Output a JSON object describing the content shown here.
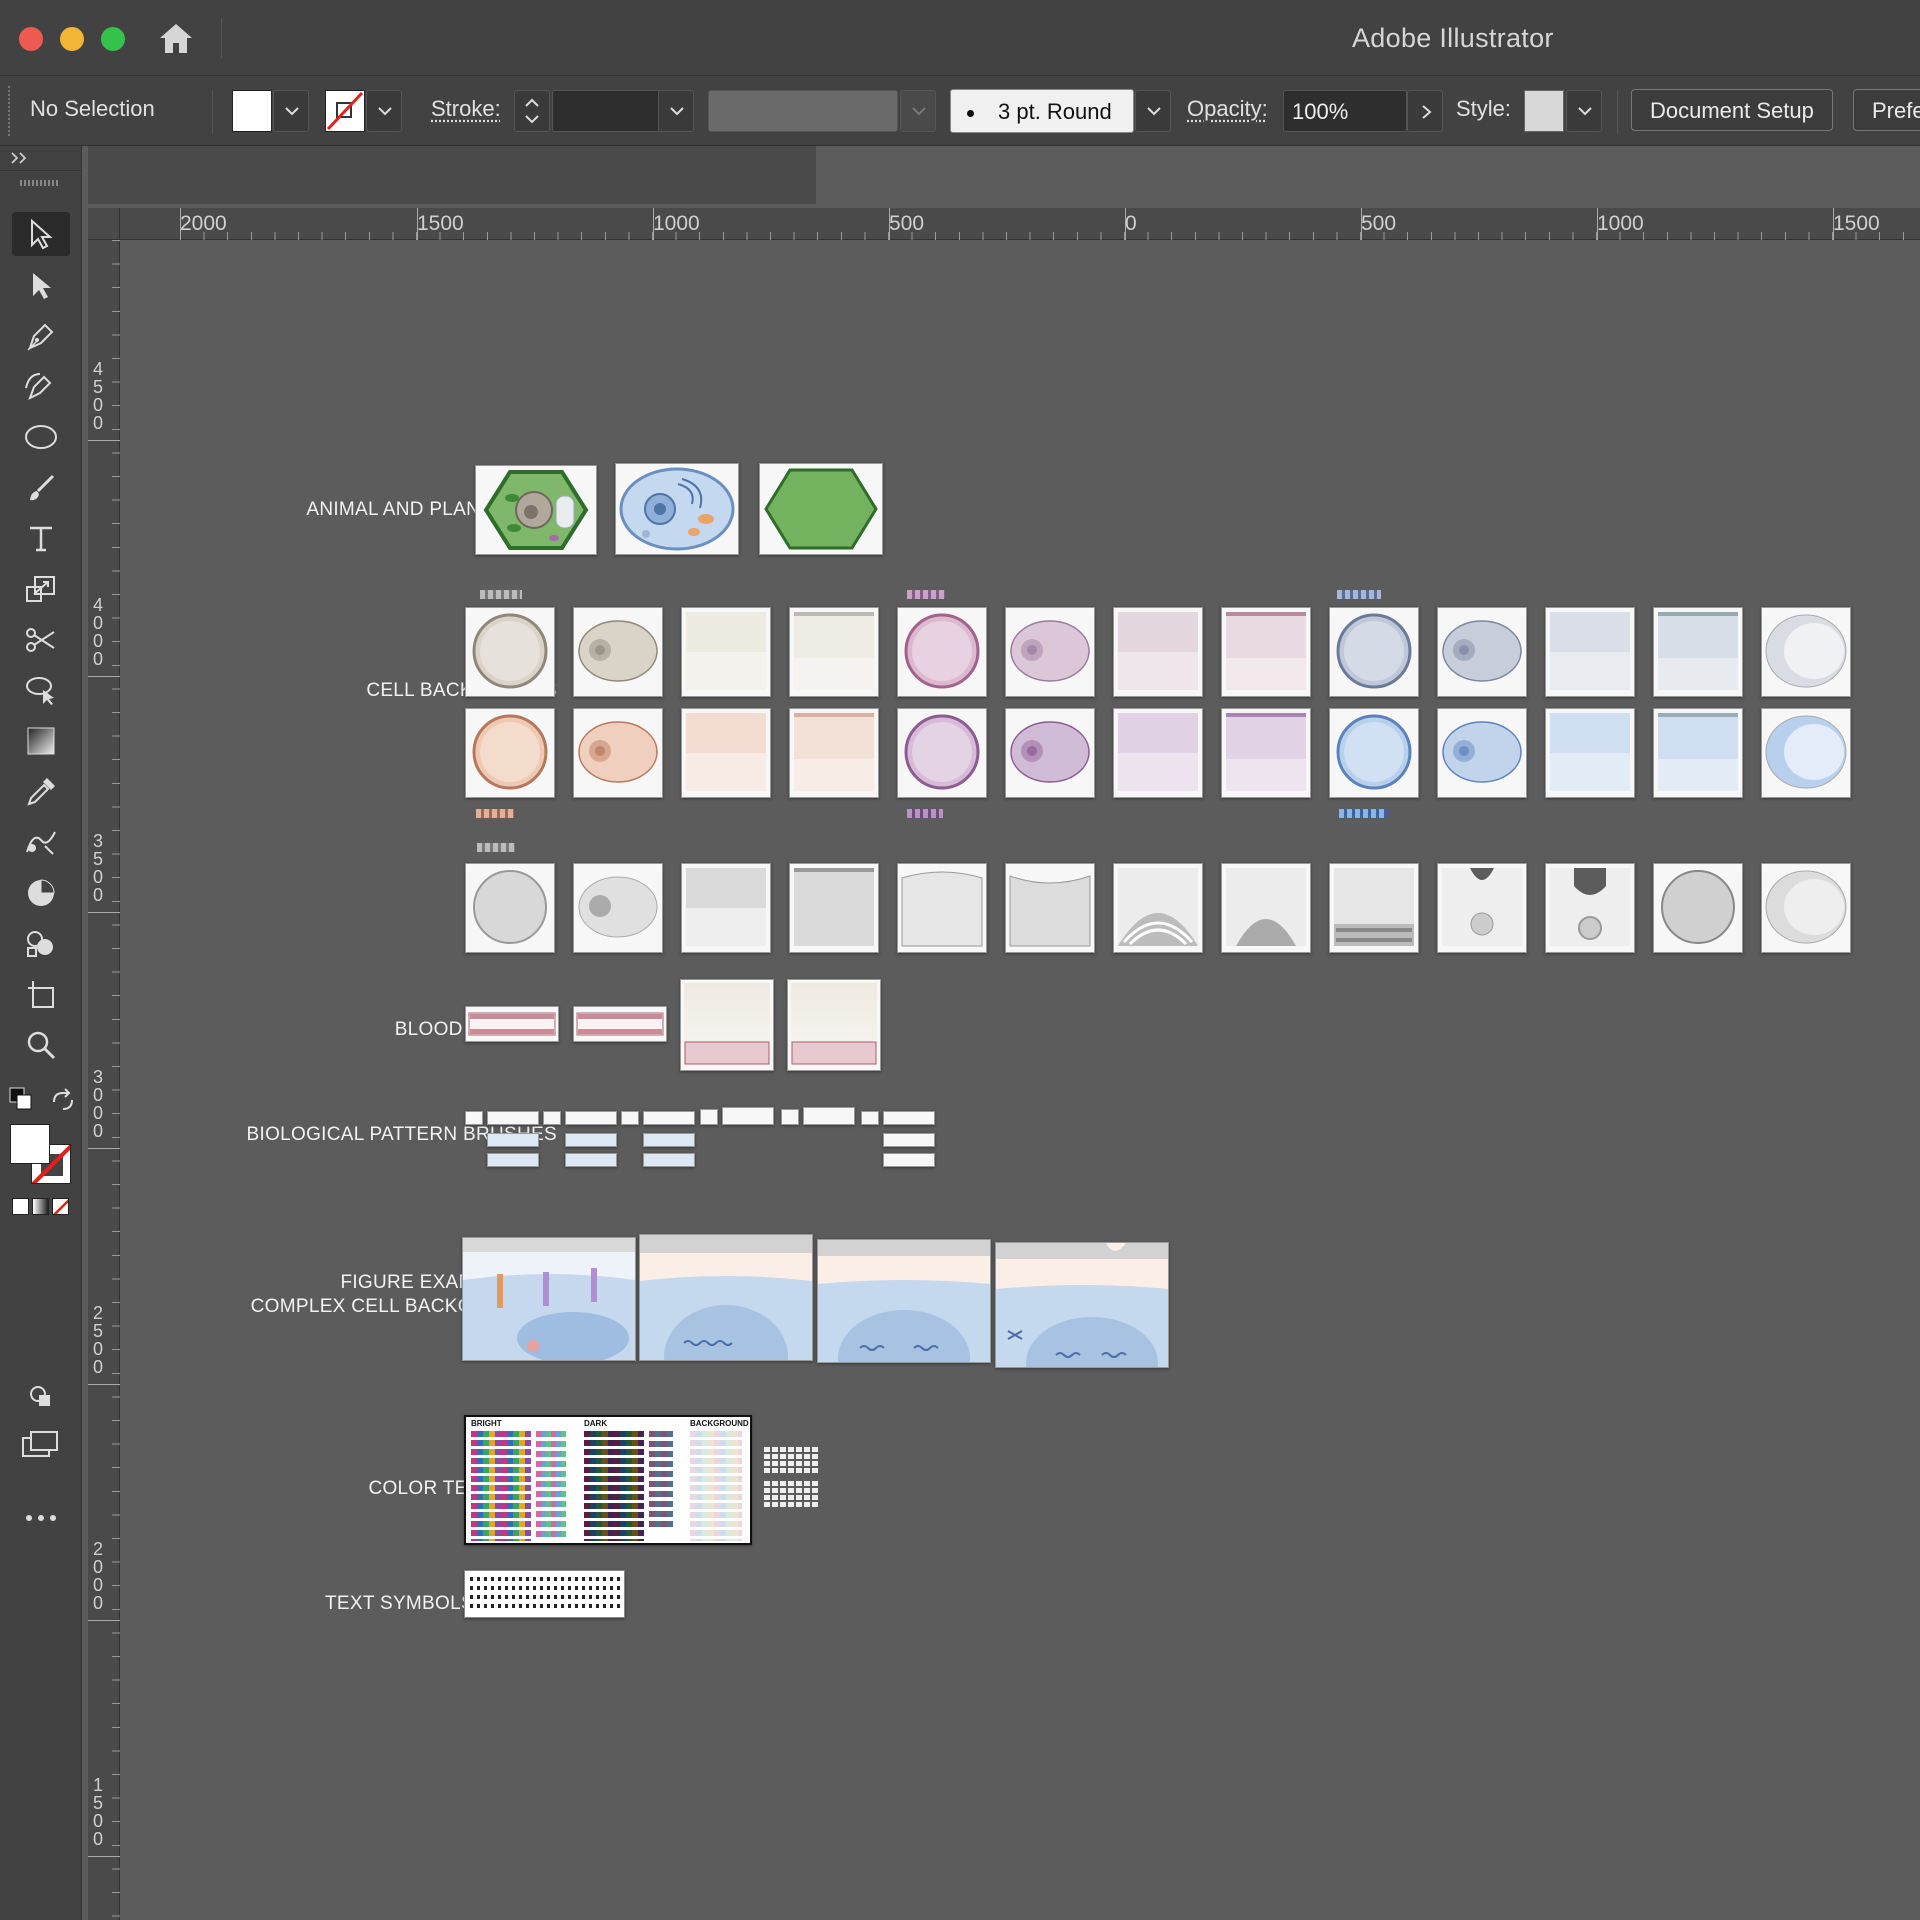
{
  "window": {
    "title": "Adobe Illustrator"
  },
  "control_bar": {
    "selection": "No Selection",
    "stroke_label": "Stroke:",
    "brush_value": "3 pt. Round",
    "opacity_label": "Opacity:",
    "opacity_value": "100%",
    "style_label": "Style:",
    "document_setup": "Document Setup",
    "preferences": "Prefe"
  },
  "ruler": {
    "horizontal": [
      "2000",
      "1500",
      "1000",
      "500",
      "0",
      "500",
      "1000",
      "1500"
    ],
    "vertical": [
      "4500",
      "4000",
      "3500",
      "3000",
      "2500",
      "2000",
      "1500"
    ]
  },
  "artboard": {
    "sections": [
      {
        "label": "ANIMAL AND PLANT CELLS"
      },
      {
        "label": "CELL BACKROUNDS"
      },
      {
        "label": "BLOOD VESSELS"
      },
      {
        "label": "BIOLOGICAL PATTERN BRUSHES"
      },
      {
        "label": "FIGURE EXAMPLE AND\nCOMPLEX CELL BACKGROUNDS"
      },
      {
        "label": "COLOR TEMPLATES"
      },
      {
        "label": "TEXT SYMBOLS/GLYPHS"
      }
    ],
    "color_template_headers": [
      "BRIGHT",
      "DARK",
      "BACKGROUND"
    ]
  }
}
